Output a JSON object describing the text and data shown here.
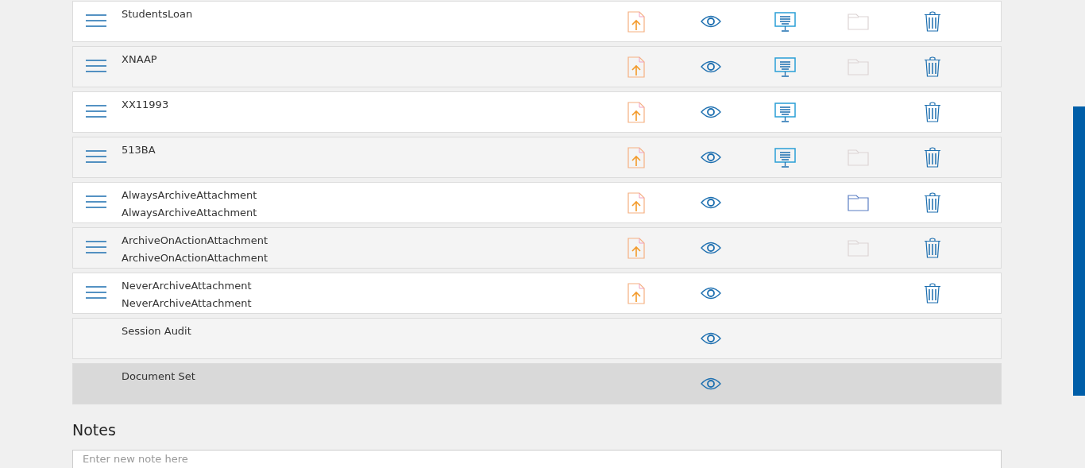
{
  "rows": [
    {
      "lines": [
        "StudentsLoan"
      ],
      "handle": true,
      "upload": true,
      "view": true,
      "preview": true,
      "folder": true,
      "folder_active": false,
      "delete": true,
      "selected": false
    },
    {
      "lines": [
        "XNAAP"
      ],
      "handle": true,
      "upload": true,
      "view": true,
      "preview": true,
      "folder": true,
      "folder_active": false,
      "delete": true,
      "selected": false
    },
    {
      "lines": [
        "XX11993"
      ],
      "handle": true,
      "upload": true,
      "view": true,
      "preview": true,
      "folder": false,
      "delete": true,
      "selected": false
    },
    {
      "lines": [
        "513BA"
      ],
      "handle": true,
      "upload": true,
      "view": true,
      "preview": true,
      "folder": true,
      "folder_active": false,
      "delete": true,
      "selected": false
    },
    {
      "lines": [
        "AlwaysArchiveAttachment",
        "AlwaysArchiveAttachment"
      ],
      "handle": true,
      "upload": true,
      "view": true,
      "preview": false,
      "folder": true,
      "folder_active": true,
      "delete": true,
      "selected": false
    },
    {
      "lines": [
        "ArchiveOnActionAttachment",
        "ArchiveOnActionAttachment"
      ],
      "handle": true,
      "upload": true,
      "view": true,
      "preview": false,
      "folder": true,
      "folder_active": false,
      "delete": true,
      "selected": false
    },
    {
      "lines": [
        "NeverArchiveAttachment",
        "NeverArchiveAttachment"
      ],
      "handle": true,
      "upload": true,
      "view": true,
      "preview": false,
      "folder": false,
      "delete": true,
      "selected": false
    },
    {
      "lines": [
        "Session Audit"
      ],
      "handle": false,
      "upload": false,
      "view": true,
      "preview": false,
      "folder": false,
      "delete": false,
      "selected": false
    },
    {
      "lines": [
        "Document Set"
      ],
      "handle": false,
      "upload": false,
      "view": true,
      "preview": false,
      "folder": false,
      "delete": false,
      "selected": true
    }
  ],
  "notes": {
    "title": "Notes",
    "placeholder": "Enter new note here"
  }
}
